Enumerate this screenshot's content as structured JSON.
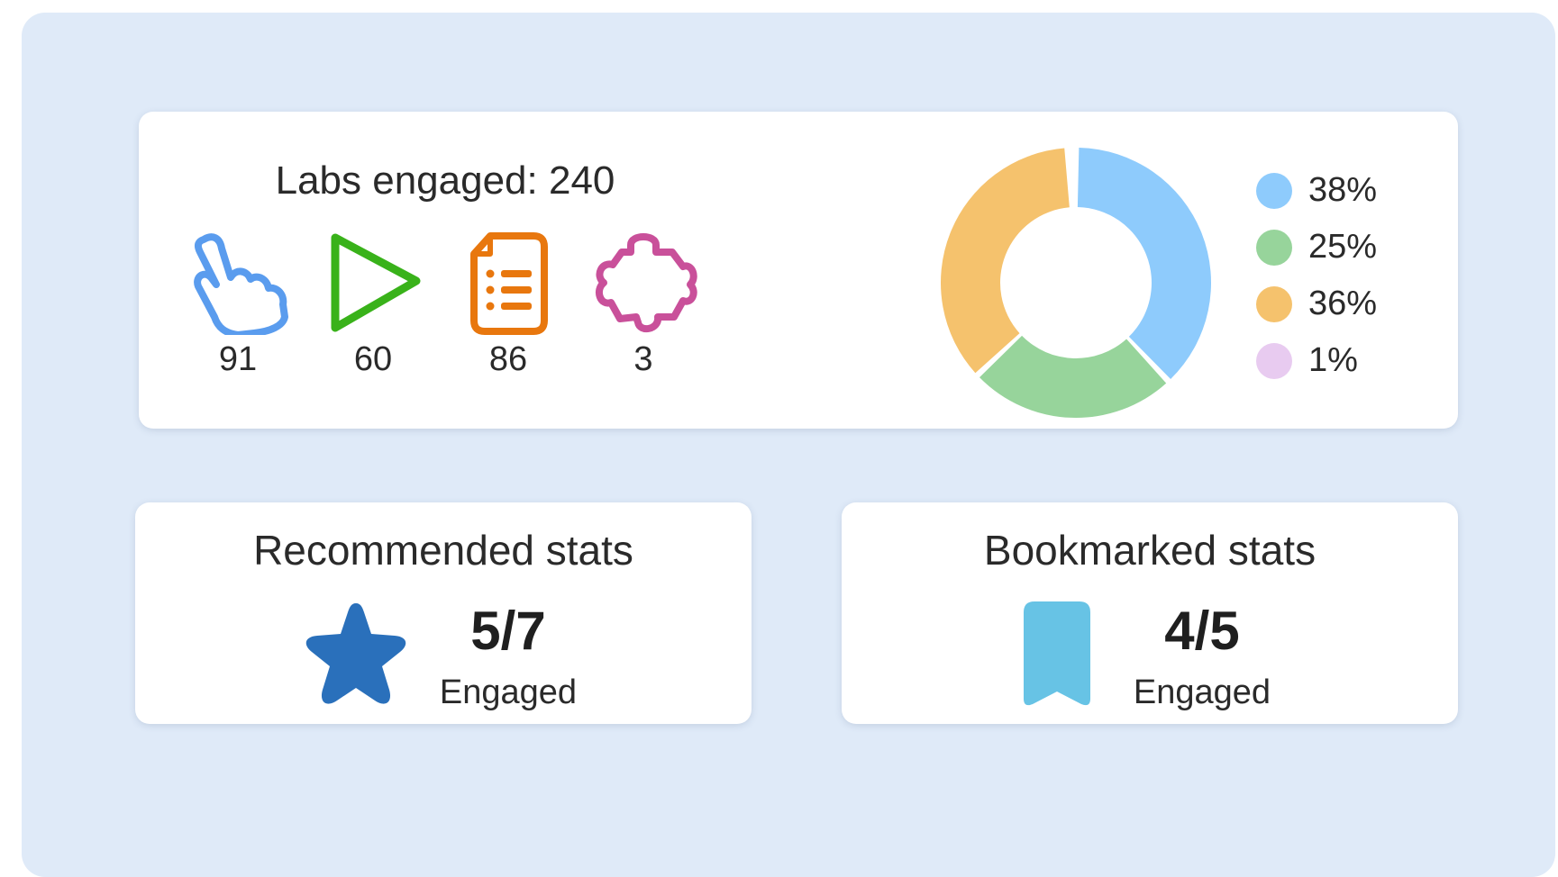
{
  "labs": {
    "title": "Labs engaged: 240",
    "items": [
      {
        "icon": "pointer-hand-icon",
        "count": "91",
        "color": "#5a9cee"
      },
      {
        "icon": "play-icon",
        "count": "60",
        "color": "#39b21a"
      },
      {
        "icon": "document-list-icon",
        "count": "86",
        "color": "#e8770e"
      },
      {
        "icon": "puzzle-piece-icon",
        "count": "3",
        "color": "#c9509a"
      }
    ]
  },
  "chart_data": {
    "type": "pie",
    "variant": "donut",
    "values": [
      38,
      25,
      36,
      1
    ],
    "labels": [
      "38%",
      "25%",
      "36%",
      "1%"
    ],
    "colors": [
      "#8ecbfc",
      "#97d49b",
      "#f5c26d",
      "#e8cbf0"
    ],
    "legend_position": "right"
  },
  "recommended": {
    "title": "Recommended stats",
    "value": "5/7",
    "subtitle": "Engaged",
    "icon": "star-icon",
    "color": "#2a70bb"
  },
  "bookmarked": {
    "title": "Bookmarked stats",
    "value": "4/5",
    "subtitle": "Engaged",
    "icon": "bookmark-icon",
    "color": "#67c3e5"
  }
}
